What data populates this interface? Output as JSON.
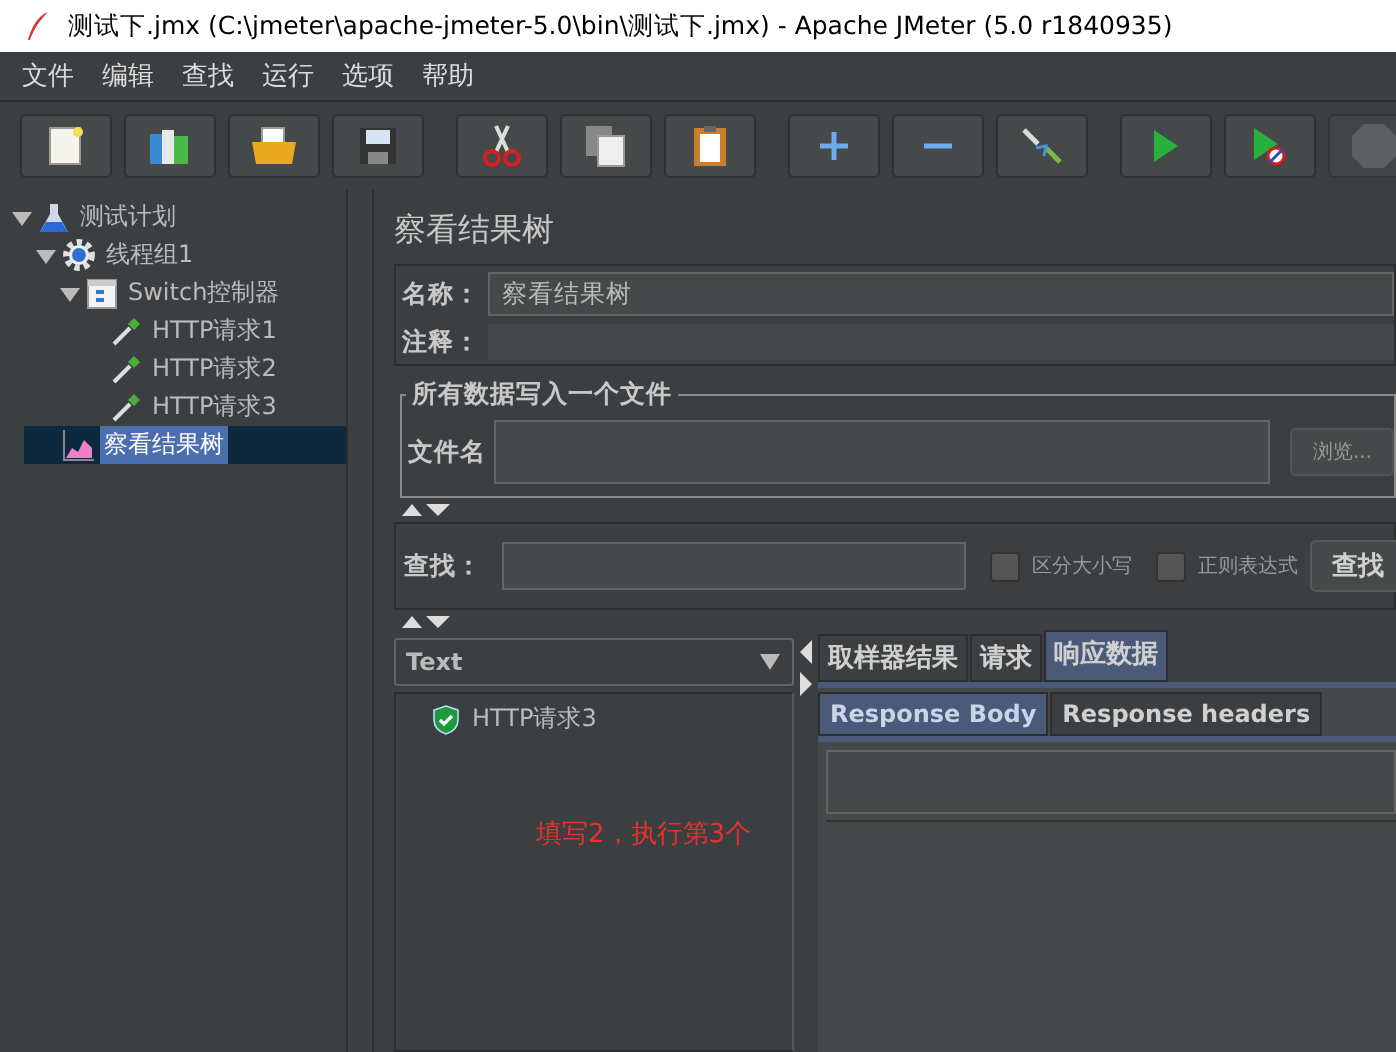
{
  "window": {
    "title": "测试下.jmx (C:\\jmeter\\apache-jmeter-5.0\\bin\\测试下.jmx) - Apache JMeter (5.0 r1840935)"
  },
  "menu": [
    "文件",
    "编辑",
    "查找",
    "运行",
    "选项",
    "帮助"
  ],
  "toolbar": [
    {
      "disabled": false
    },
    {
      "disabled": false
    },
    {
      "disabled": false
    },
    {
      "disabled": false
    },
    {
      "disabled": false
    },
    {
      "disabled": false
    },
    {
      "disabled": false
    },
    {
      "disabled": false
    },
    {
      "disabled": false
    },
    {
      "disabled": false
    },
    {
      "disabled": false
    },
    {
      "disabled": false
    },
    {
      "disabled": true
    }
  ],
  "tree": [
    {
      "label": "测试计划",
      "kind": "plan",
      "expanded": true,
      "selected": false,
      "children": [
        {
          "label": "线程组1",
          "kind": "threadgroup",
          "expanded": true,
          "selected": false,
          "children": [
            {
              "label": "Switch控制器",
              "kind": "controller",
              "expanded": true,
              "selected": false,
              "children": [
                {
                  "label": "HTTP请求1",
                  "kind": "sampler",
                  "selected": false
                },
                {
                  "label": "HTTP请求2",
                  "kind": "sampler",
                  "selected": false
                },
                {
                  "label": "HTTP请求3",
                  "kind": "sampler",
                  "selected": false
                }
              ]
            }
          ]
        },
        {
          "label": "察看结果树",
          "kind": "listener",
          "selected": true
        }
      ]
    }
  ],
  "panel": {
    "title": "察看结果树",
    "name_label": "名称：",
    "name_value": "察看结果树",
    "comment_label": "注释：",
    "file_group": {
      "legend": "所有数据写入一个文件",
      "file_label": "文件名",
      "browse_button": "浏览..."
    },
    "search": {
      "label": "查找：",
      "case_label": "区分大小写",
      "case_checked": false,
      "regex_label": "正则表达式",
      "regex_checked": false,
      "button": "查找"
    },
    "renderer": "Text",
    "results": [
      {
        "label": "HTTP请求3",
        "kind": "success"
      }
    ],
    "tabs": [
      {
        "label": "取样器结果",
        "selected": false
      },
      {
        "label": "请求",
        "selected": false
      },
      {
        "label": "响应数据",
        "selected": true
      }
    ],
    "subtabs": [
      {
        "label": "Response Body",
        "selected": true
      },
      {
        "label": "Response headers",
        "selected": false
      }
    ],
    "annotation": "填写2，执行第3个"
  }
}
